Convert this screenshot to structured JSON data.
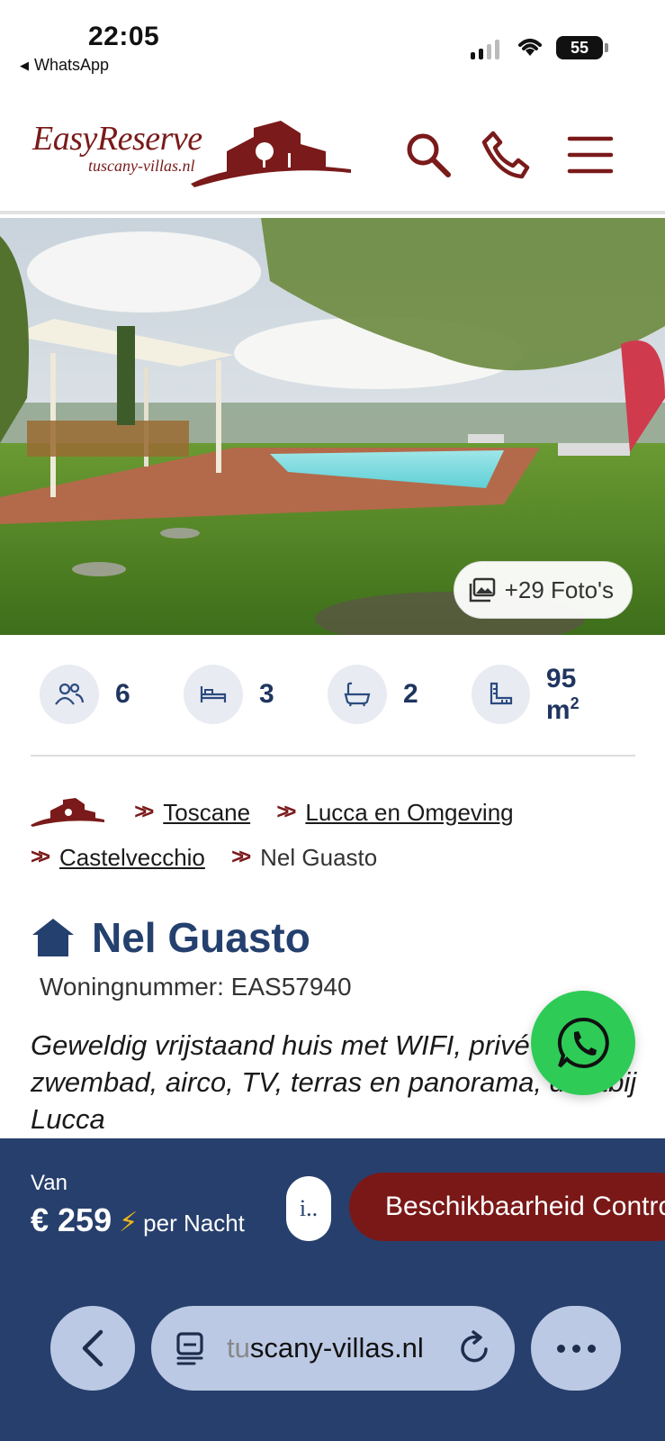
{
  "status_bar": {
    "time": "22:05",
    "back_app": "WhatsApp",
    "battery": "55"
  },
  "header": {
    "logo_main": "EasyReserve",
    "logo_sub": "tuscany-villas.nl",
    "icons": [
      "search-icon",
      "phone-icon",
      "menu-icon"
    ],
    "brand_color": "#7a1a1a"
  },
  "hero": {
    "photos_label": "+29 Foto's"
  },
  "stats": [
    {
      "icon": "guests-icon",
      "value": "6"
    },
    {
      "icon": "bed-icon",
      "value": "3"
    },
    {
      "icon": "bath-icon",
      "value": "2"
    },
    {
      "icon": "area-icon",
      "value": "95 m",
      "sup": "2"
    }
  ],
  "breadcrumb": {
    "items": [
      {
        "label": "Toscane",
        "link": true
      },
      {
        "label": "Lucca en Omgeving",
        "link": true
      },
      {
        "label": "Castelvecchio",
        "link": true
      },
      {
        "label": "Nel Guasto",
        "link": false
      }
    ]
  },
  "property": {
    "title": "Nel Guasto",
    "number": "Woningnummer: EAS57940",
    "description": "Geweldig vrijstaand huis met WIFI, privé zwembad, airco, TV, terras en panorama, dichtbij Lucca"
  },
  "booking": {
    "from_label": "Van",
    "price": "€ 259",
    "per_label": "per Nacht",
    "info_label": "i..",
    "availability_label": "Beschikbaarheid Controleren",
    "accent_color": "#7a1818",
    "bar_color": "#273f6c"
  },
  "browser": {
    "url_fade": "tu",
    "url": "scany-villas.nl"
  }
}
